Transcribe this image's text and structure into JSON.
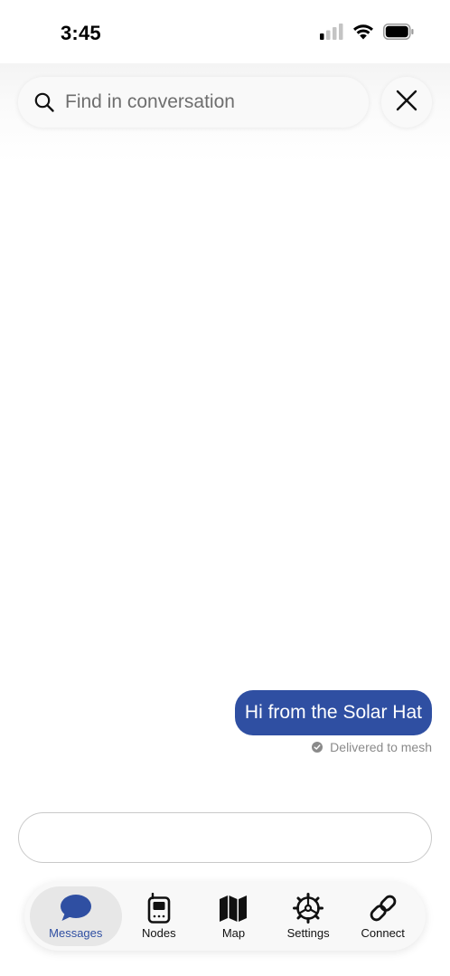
{
  "status_bar": {
    "time": "3:45"
  },
  "search": {
    "placeholder": "Find in conversation"
  },
  "conversation": {
    "messages": [
      {
        "text": "Hi from the Solar Hat",
        "status": "Delivered to mesh"
      }
    ]
  },
  "compose": {
    "value": ""
  },
  "tab_bar": {
    "tabs": [
      {
        "label": "Messages",
        "icon": "chat-bubble-icon",
        "active": true
      },
      {
        "label": "Nodes",
        "icon": "radio-device-icon",
        "active": false
      },
      {
        "label": "Map",
        "icon": "map-icon",
        "active": false
      },
      {
        "label": "Settings",
        "icon": "gear-icon",
        "active": false
      },
      {
        "label": "Connect",
        "icon": "link-icon",
        "active": false
      }
    ]
  },
  "colors": {
    "accent": "#2f4fa2",
    "bubble_text": "#ffffff",
    "muted_text": "#8a8a8a"
  }
}
